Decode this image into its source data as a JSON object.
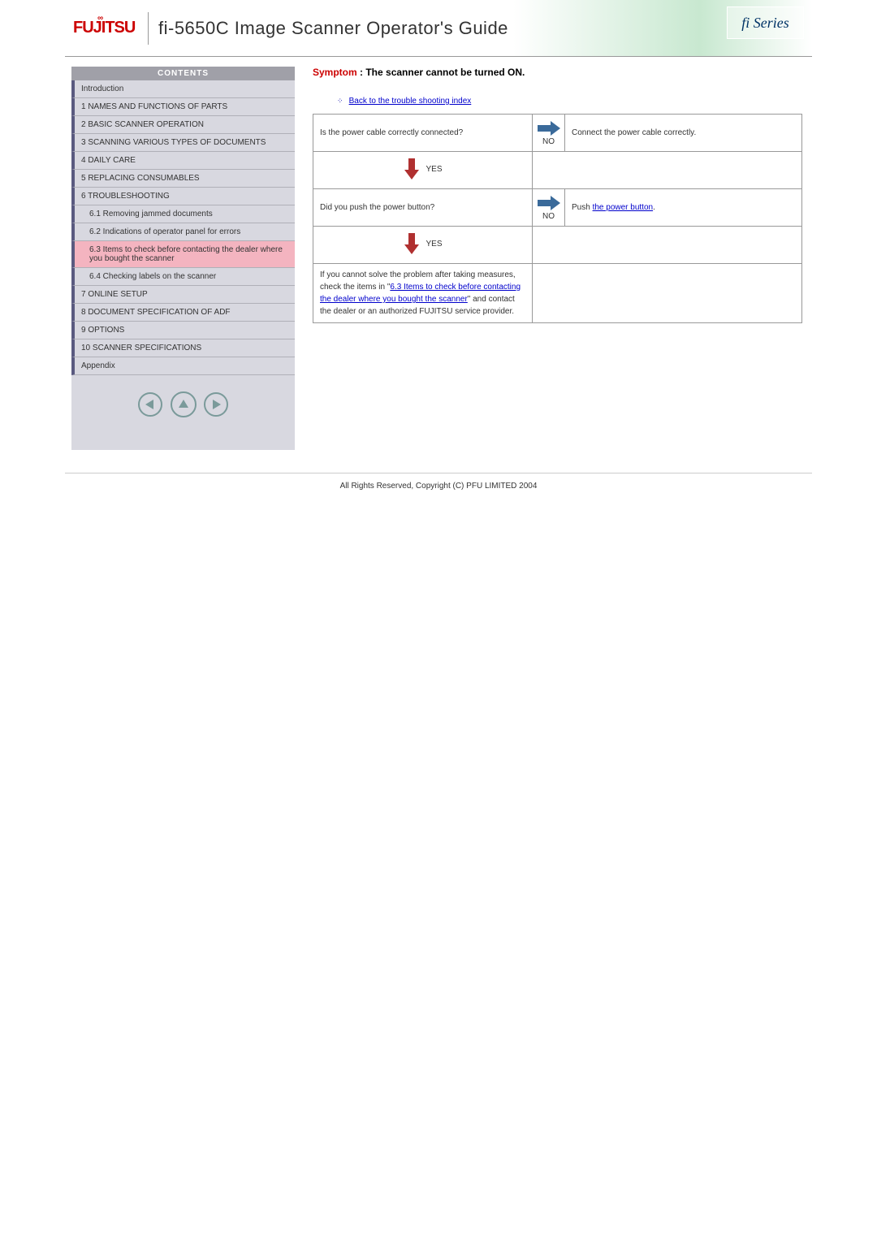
{
  "header": {
    "logo": "FUJITSU",
    "title": "fi-5650C Image Scanner Operator's Guide",
    "series": "fi Series"
  },
  "sidebar": {
    "contents_label": "CONTENTS",
    "items": [
      "Introduction",
      "1 NAMES AND FUNCTIONS OF PARTS",
      "2 BASIC SCANNER OPERATION",
      "3 SCANNING VARIOUS TYPES OF DOCUMENTS",
      "4 DAILY CARE",
      "5 REPLACING CONSUMABLES",
      "6 TROUBLESHOOTING"
    ],
    "subitems": [
      "6.1 Removing jammed documents",
      "6.2 Indications of operator panel for errors",
      "6.3 Items to check before contacting the dealer where you bought the scanner",
      "6.4 Checking labels on the scanner"
    ],
    "items2": [
      "7 ONLINE SETUP",
      "8 DOCUMENT SPECIFICATION OF ADF",
      "9 OPTIONS",
      "10 SCANNER SPECIFICATIONS",
      "Appendix"
    ]
  },
  "main": {
    "symptom_label": "Symptom",
    "symptom_text": " : The scanner cannot be turned ON.",
    "back_link": "Back to the trouble shooting index",
    "flow": {
      "q1": "Is the power cable correctly connected?",
      "no1": "NO",
      "a1": "Connect the power cable correctly.",
      "yes1": "YES",
      "q2": "Did you push the power button?",
      "no2": "NO",
      "a2_pre": "Push ",
      "a2_link": "the power button",
      "a2_post": ".",
      "yes2": "YES",
      "final_pre": "If you cannot solve the problem after taking measures, check the items in \"",
      "final_link": "6.3 Items to check before contacting the dealer where you bought the scanner",
      "final_post": "\" and contact the dealer or an authorized FUJITSU service provider."
    }
  },
  "footer": "All Rights Reserved, Copyright (C) PFU LIMITED 2004"
}
